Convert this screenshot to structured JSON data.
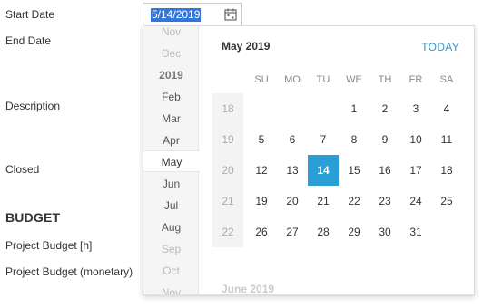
{
  "form": {
    "start_date_label": "Start Date",
    "end_date_label": "End Date",
    "description_label": "Description",
    "closed_label": "Closed",
    "budget_heading": "BUDGET",
    "project_budget_h_label": "Project Budget [h]",
    "project_budget_monetary_label": "Project Budget (monetary)"
  },
  "start_date": {
    "value": "5/14/2019",
    "icon": "calendar-icon"
  },
  "month_rail": [
    "Nov",
    "Dec",
    "2019",
    "Feb",
    "Mar",
    "Apr",
    "May",
    "Jun",
    "Jul",
    "Aug",
    "Sep",
    "Oct",
    "Nov"
  ],
  "month_rail_selected": "May",
  "calendar": {
    "title": "May 2019",
    "today_label": "TODAY",
    "weekdays": [
      "SU",
      "MO",
      "TU",
      "WE",
      "TH",
      "FR",
      "SA"
    ],
    "week_numbers": [
      "18",
      "19",
      "20",
      "21",
      "22"
    ],
    "weeks": [
      [
        "",
        "",
        "",
        "1",
        "2",
        "3",
        "4"
      ],
      [
        "5",
        "6",
        "7",
        "8",
        "9",
        "10",
        "11"
      ],
      [
        "12",
        "13",
        "14",
        "15",
        "16",
        "17",
        "18"
      ],
      [
        "19",
        "20",
        "21",
        "22",
        "23",
        "24",
        "25"
      ],
      [
        "26",
        "27",
        "28",
        "29",
        "30",
        "31",
        ""
      ]
    ],
    "selected_day": "14",
    "next_month_title": "June 2019"
  },
  "colors": {
    "accent": "#2a9fd6",
    "link": "#3399cc",
    "selection": "#3377dd"
  }
}
